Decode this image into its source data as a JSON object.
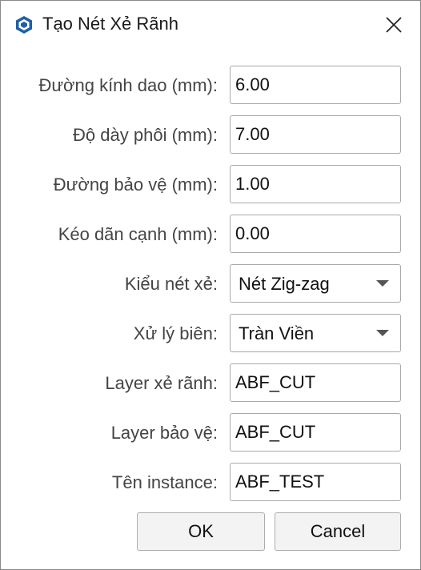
{
  "window": {
    "title": "Tạo Nét Xẻ Rãnh",
    "icon": "sketchup-icon",
    "close_icon": "close-icon"
  },
  "form": {
    "tool_diameter": {
      "label": "Đường kính dao (mm):",
      "value": "6.00"
    },
    "blank_thickness": {
      "label": "Độ dày phôi (mm):",
      "value": "7.00"
    },
    "guard_line": {
      "label": "Đường bảo vệ (mm):",
      "value": "1.00"
    },
    "edge_stretch": {
      "label": "Kéo dãn cạnh (mm):",
      "value": "0.00"
    },
    "cut_style": {
      "label": "Kiểu nét xẻ:",
      "selected": "Nét Zig-zag"
    },
    "edge_handling": {
      "label": "Xử lý biên:",
      "selected": "Tràn Viền"
    },
    "cut_layer": {
      "label": "Layer xẻ rãnh:",
      "value": "ABF_CUT"
    },
    "guard_layer": {
      "label": "Layer bảo vệ:",
      "value": "ABF_CUT"
    },
    "instance_name": {
      "label": "Tên instance:",
      "value": "ABF_TEST"
    }
  },
  "buttons": {
    "ok": "OK",
    "cancel": "Cancel"
  },
  "colors": {
    "icon_blue": "#1f5fa8",
    "label_gray": "#444444",
    "border": "#a9a9a9"
  }
}
